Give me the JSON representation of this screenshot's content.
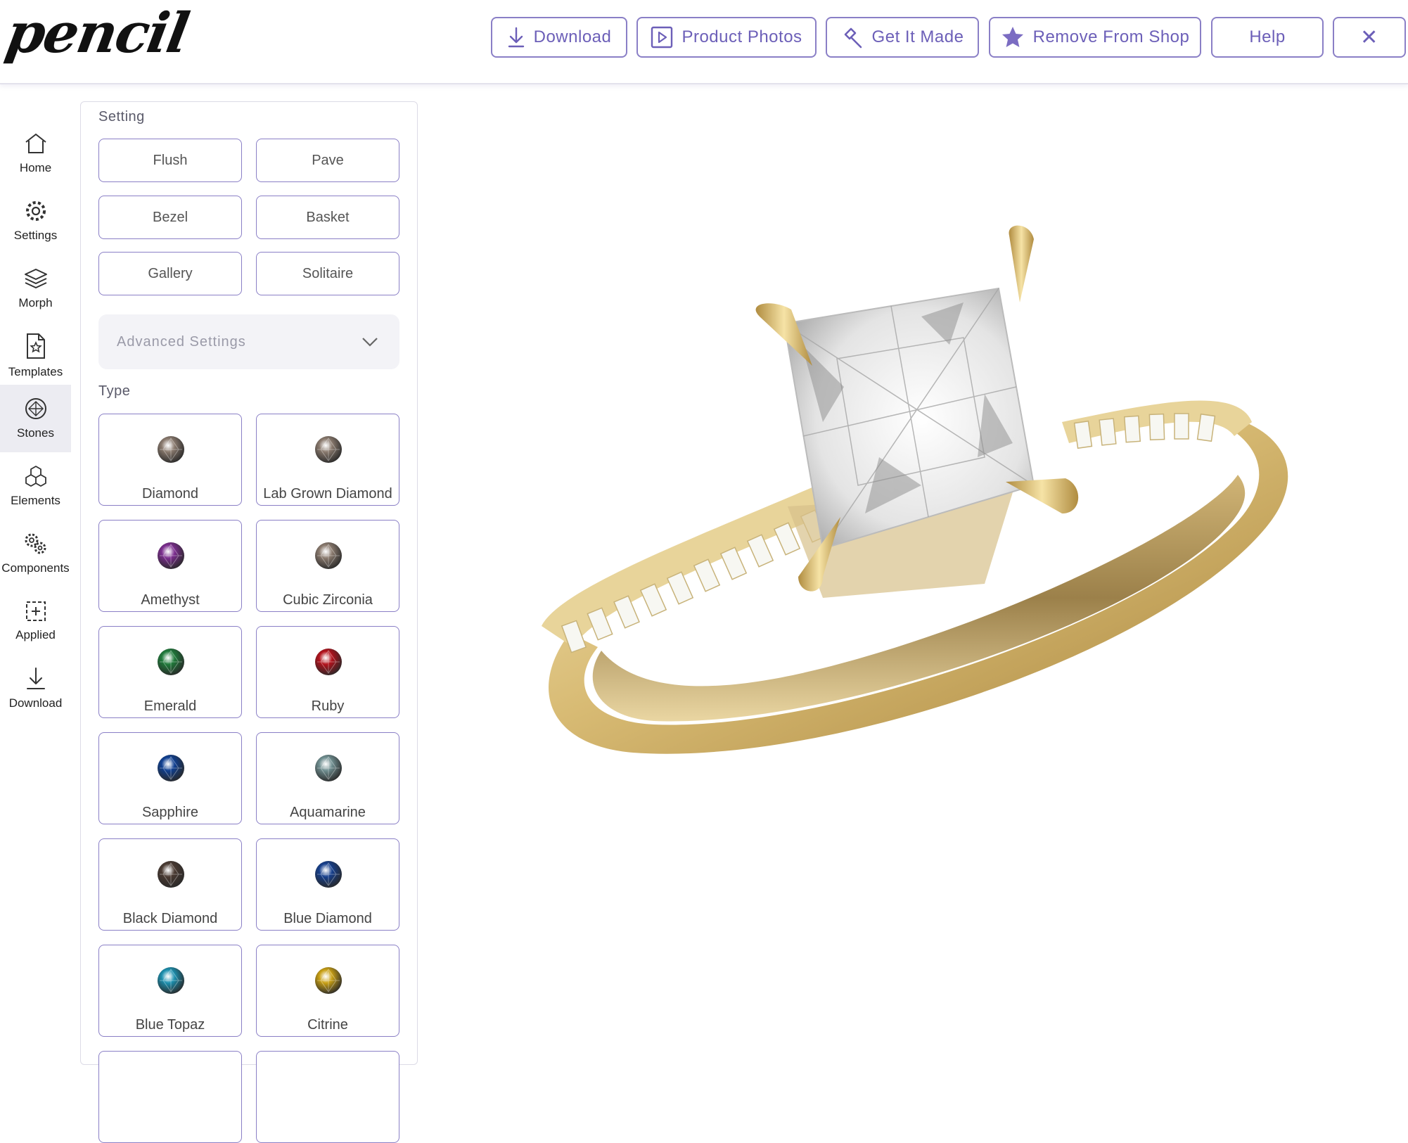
{
  "app": {
    "logo_text": "pencil"
  },
  "toolbar": {
    "buttons": [
      {
        "label": "Download",
        "icon": "download-icon"
      },
      {
        "label": "Product Photos",
        "icon": "play-square-icon"
      },
      {
        "label": "Get It Made",
        "icon": "hammer-icon"
      },
      {
        "label": "Remove From Shop",
        "icon": "star-icon"
      },
      {
        "label": "Help"
      },
      {
        "label": "✕",
        "icon": "close-icon"
      }
    ]
  },
  "sidebar": {
    "items": [
      {
        "label": "Home",
        "icon": "home-icon"
      },
      {
        "label": "Settings",
        "icon": "gear-icon"
      },
      {
        "label": "Morph",
        "icon": "layers-icon"
      },
      {
        "label": "Templates",
        "icon": "template-icon"
      },
      {
        "label": "Stones",
        "icon": "gem-icon",
        "active": true
      },
      {
        "label": "Elements",
        "icon": "cubes-icon"
      },
      {
        "label": "Components",
        "icon": "gears-icon"
      },
      {
        "label": "Applied",
        "icon": "applied-icon"
      },
      {
        "label": "Download",
        "icon": "download-icon"
      }
    ]
  },
  "panel": {
    "setting_title": "Setting",
    "settings": [
      "Flush",
      "Pave",
      "Bezel",
      "Basket",
      "Gallery",
      "Solitaire"
    ],
    "advanced_label": "Advanced Settings",
    "type_title": "Type",
    "stones": [
      {
        "name": "Diamond",
        "color": "#8a7a6e"
      },
      {
        "name": "Lab Grown Diamond",
        "color": "#8a7a6e"
      },
      {
        "name": "Amethyst",
        "color": "#7b2d8e"
      },
      {
        "name": "Cubic Zirconia",
        "color": "#8a7a6e"
      },
      {
        "name": "Emerald",
        "color": "#1f7a3a"
      },
      {
        "name": "Ruby",
        "color": "#b3121c"
      },
      {
        "name": "Sapphire",
        "color": "#0f3f91"
      },
      {
        "name": "Aquamarine",
        "color": "#6f8e90"
      },
      {
        "name": "Black Diamond",
        "color": "#4a3a32"
      },
      {
        "name": "Blue Diamond",
        "color": "#163f8c"
      },
      {
        "name": "Blue Topaz",
        "color": "#1b8fae"
      },
      {
        "name": "Citrine",
        "color": "#c9a014"
      }
    ]
  },
  "colors": {
    "accent": "#6c5fb8",
    "border": "#8a7fc6",
    "gold": "#d4b872"
  }
}
